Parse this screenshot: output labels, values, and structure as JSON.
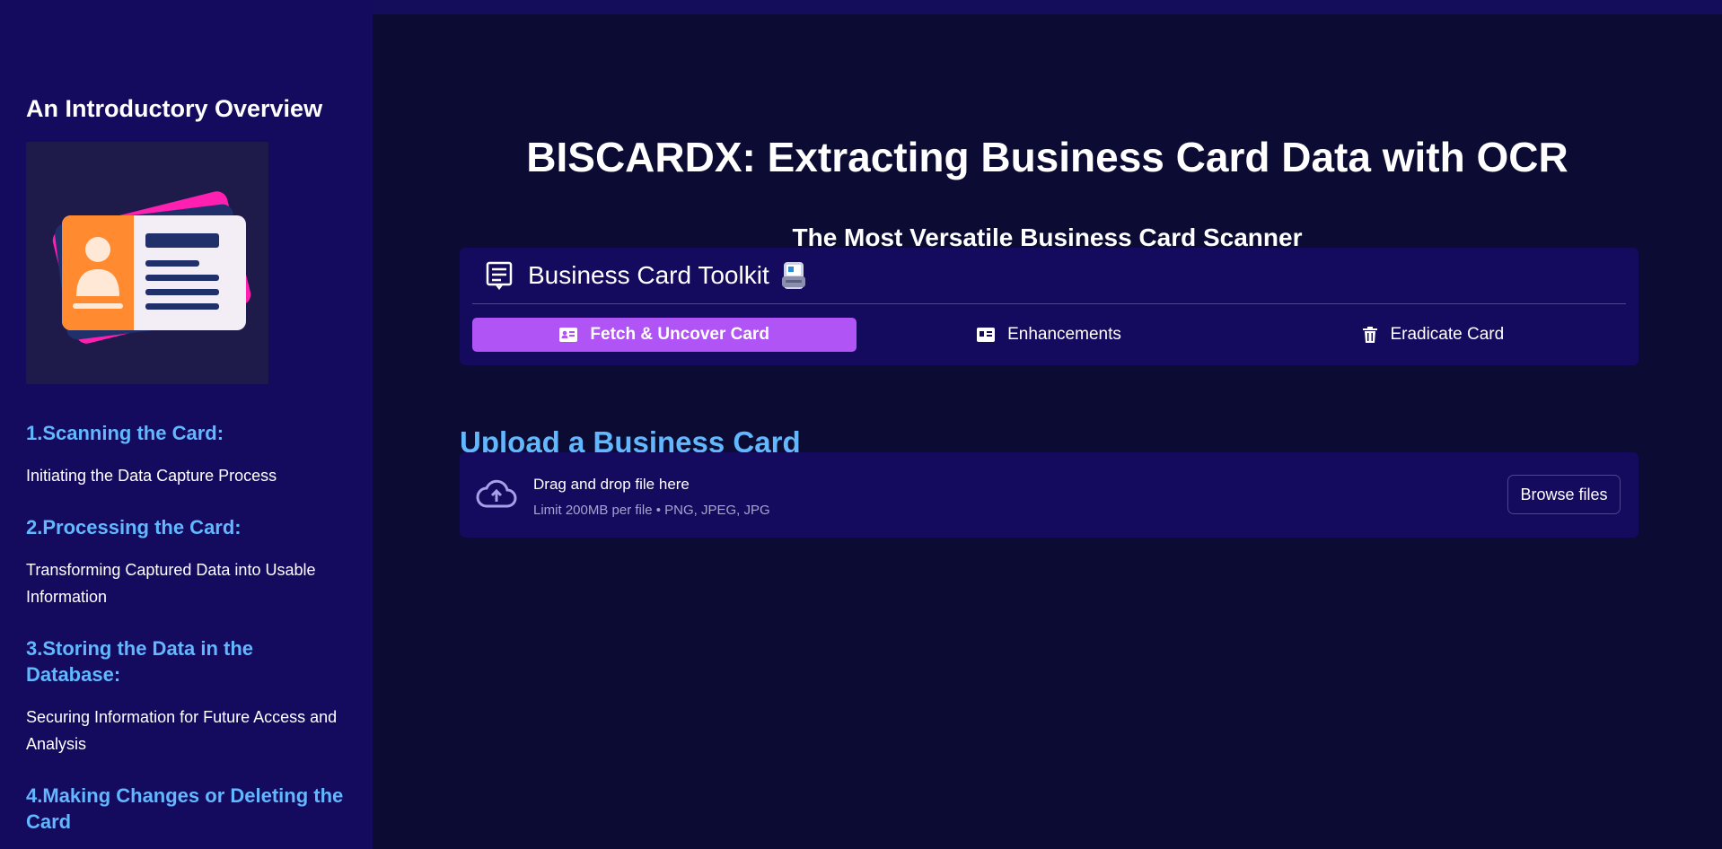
{
  "sidebar": {
    "title": "An Introductory Overview",
    "steps": [
      {
        "title": "1.Scanning the Card:",
        "desc": "Initiating the Data Capture Process"
      },
      {
        "title": "2.Processing the Card:",
        "desc": "Transforming Captured Data into Usable Information"
      },
      {
        "title": "3.Storing the Data in the Database:",
        "desc": "Securing Information for Future Access and Analysis"
      },
      {
        "title": "4.Making Changes or Deleting the Card"
      }
    ]
  },
  "main": {
    "title": "BISCARDX: Extracting Business Card Data with OCR",
    "subtitle": "The Most Versatile Business Card Scanner"
  },
  "toolkit": {
    "title": "Business Card Toolkit",
    "tabs": [
      {
        "label": "Fetch & Uncover Card",
        "icon": "id-card-icon",
        "active": true
      },
      {
        "label": "Enhancements",
        "icon": "id-card-icon",
        "active": false
      },
      {
        "label": "Eradicate Card",
        "icon": "trash-icon",
        "active": false
      }
    ]
  },
  "upload": {
    "heading": "Upload a Business Card",
    "drop_label": "Drag and drop file here",
    "limit_text": "Limit 200MB per file • PNG, JPEG, JPG",
    "browse_label": "Browse files"
  },
  "colors": {
    "sidebar_bg": "#140a5e",
    "main_bg": "#0b0b33",
    "accent": "#b054f5",
    "heading_blue": "#62b8ff"
  }
}
